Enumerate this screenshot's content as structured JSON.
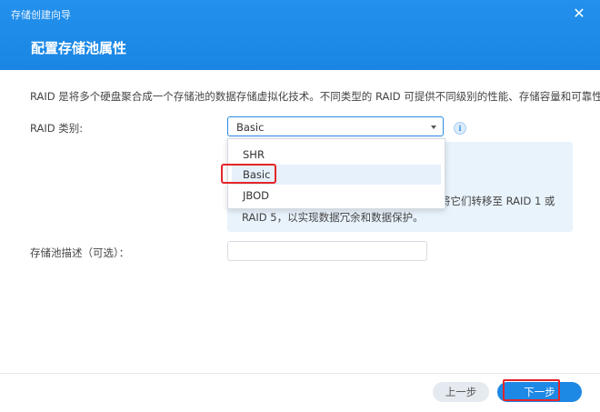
{
  "window": {
    "title": "存储创建向导",
    "close_icon": "close-icon"
  },
  "page": {
    "title": "配置存储池属性",
    "description": "RAID 是将多个硬盘聚合成一个存储池的数据存储虚拟化技术。不同类型的 RAID 可提供不同级别的性能、存储容量和可靠性。"
  },
  "raid": {
    "label": "RAID 类别:",
    "selected_value": "Basic",
    "options": [
      "SHR",
      "Basic",
      "JBOD"
    ],
    "info_icon": "info-icon",
    "info_line1": "将它们转移至 RAID 1 或",
    "info_line2": "RAID 5，以实现数据冗余和数据保护。"
  },
  "pool_description": {
    "label": "存储池描述（可选）：",
    "value": "",
    "placeholder": ""
  },
  "footer": {
    "prev_label": "上一步",
    "next_label": "下一步"
  },
  "colors": {
    "header": "#1e8ce8",
    "primary_button": "#1e88e5",
    "annotation_red": "#e3262a",
    "info_panel": "#e9f3fc"
  }
}
